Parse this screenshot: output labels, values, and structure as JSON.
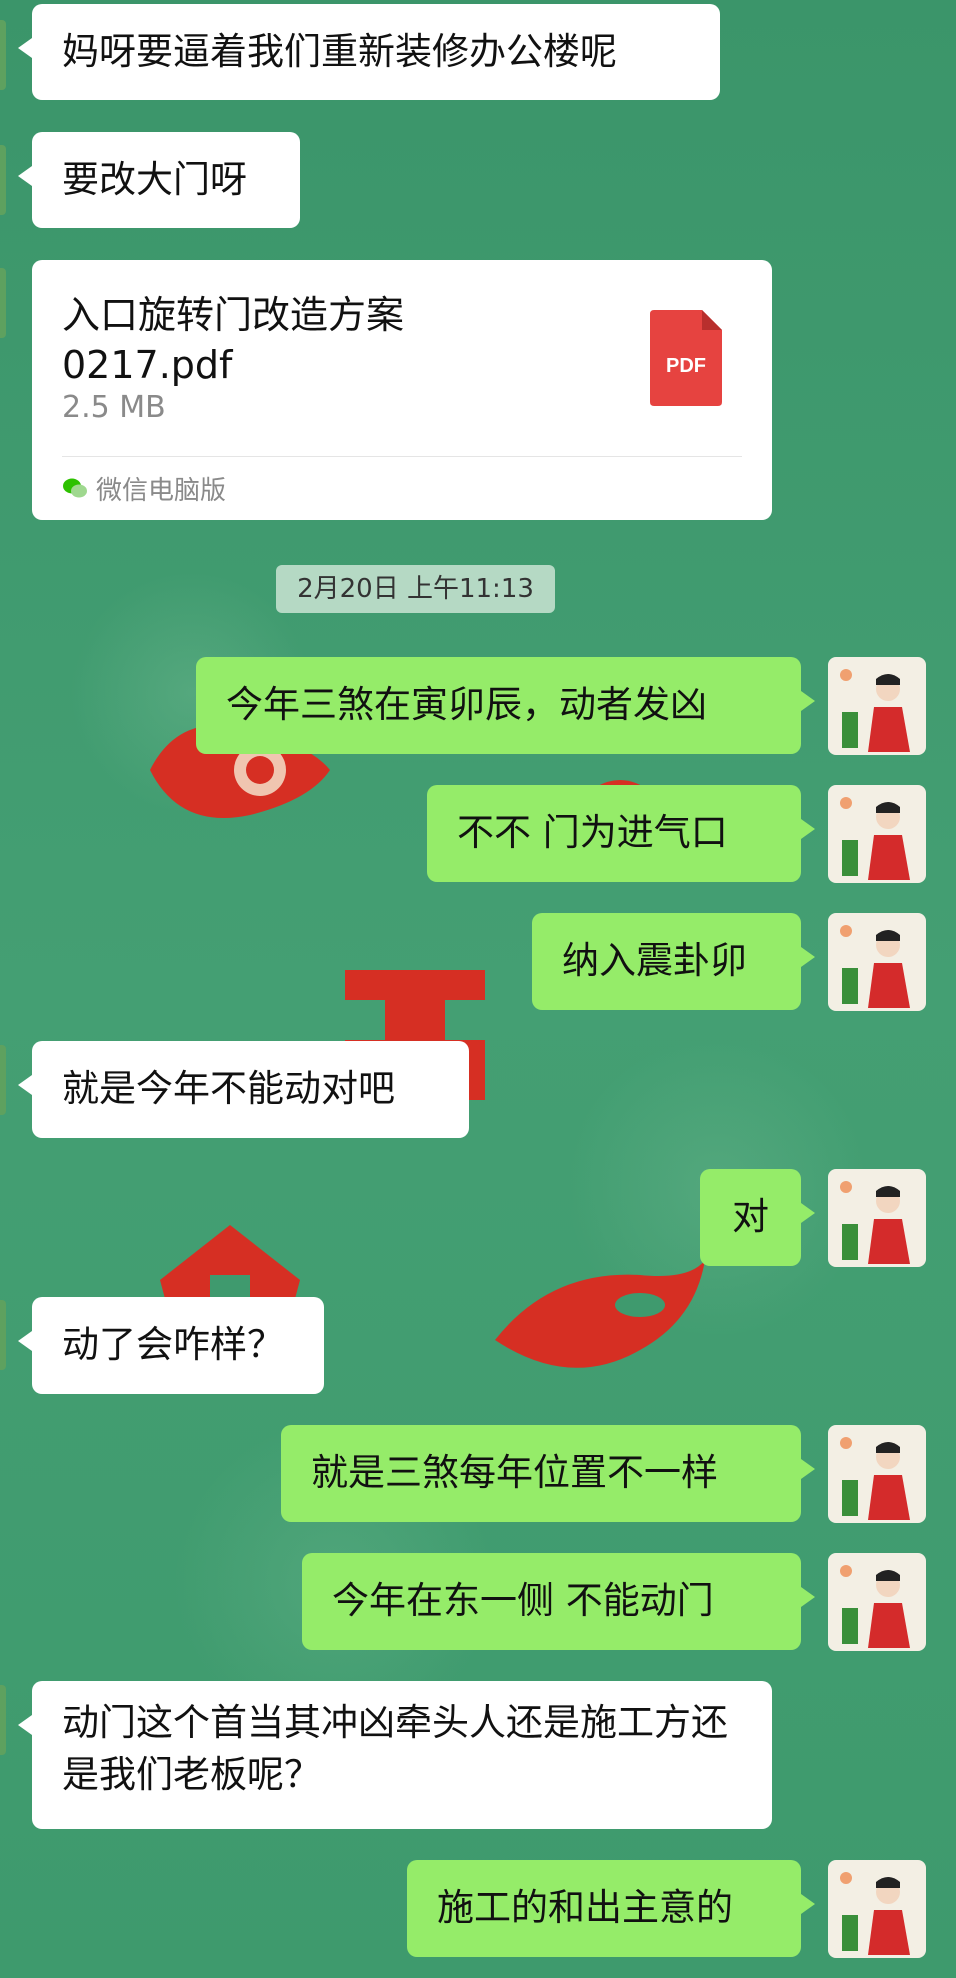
{
  "chat": {
    "file": {
      "name": "入口旋转门改造方案0217.pdf",
      "size": "2.5 MB",
      "type_badge": "PDF",
      "source": "微信电脑版"
    },
    "timestamp": "2月20日 上午11:13",
    "messages": [
      {
        "side": "in",
        "text": "妈呀要逼着我们重新装修办公楼呢"
      },
      {
        "side": "in",
        "text": "要改大门呀"
      },
      {
        "side": "out",
        "text": "今年三煞在寅卯辰，动者发凶"
      },
      {
        "side": "out",
        "text": "不不  门为进气口"
      },
      {
        "side": "out",
        "text": "纳入震卦卯"
      },
      {
        "side": "in",
        "text": "就是今年不能动对吧"
      },
      {
        "side": "out",
        "text": "对"
      },
      {
        "side": "in",
        "text": "动了会咋样？"
      },
      {
        "side": "out",
        "text": "就是三煞每年位置不一样"
      },
      {
        "side": "out",
        "text": "今年在东一侧  不能动门"
      },
      {
        "side": "in",
        "text": "动门这个首当其冲凶牵头人还是施工方还是我们老板呢？"
      },
      {
        "side": "out",
        "text": "施工的和出主意的"
      }
    ]
  },
  "colors": {
    "background": "#3f9a6e",
    "incoming_bubble": "#ffffff",
    "outgoing_bubble": "#95ec69",
    "pdf_red": "#e64340"
  },
  "icons": {
    "file_type": "pdf-file-icon",
    "source_app": "wechat-icon",
    "avatar": "hanfu-woman-avatar"
  }
}
